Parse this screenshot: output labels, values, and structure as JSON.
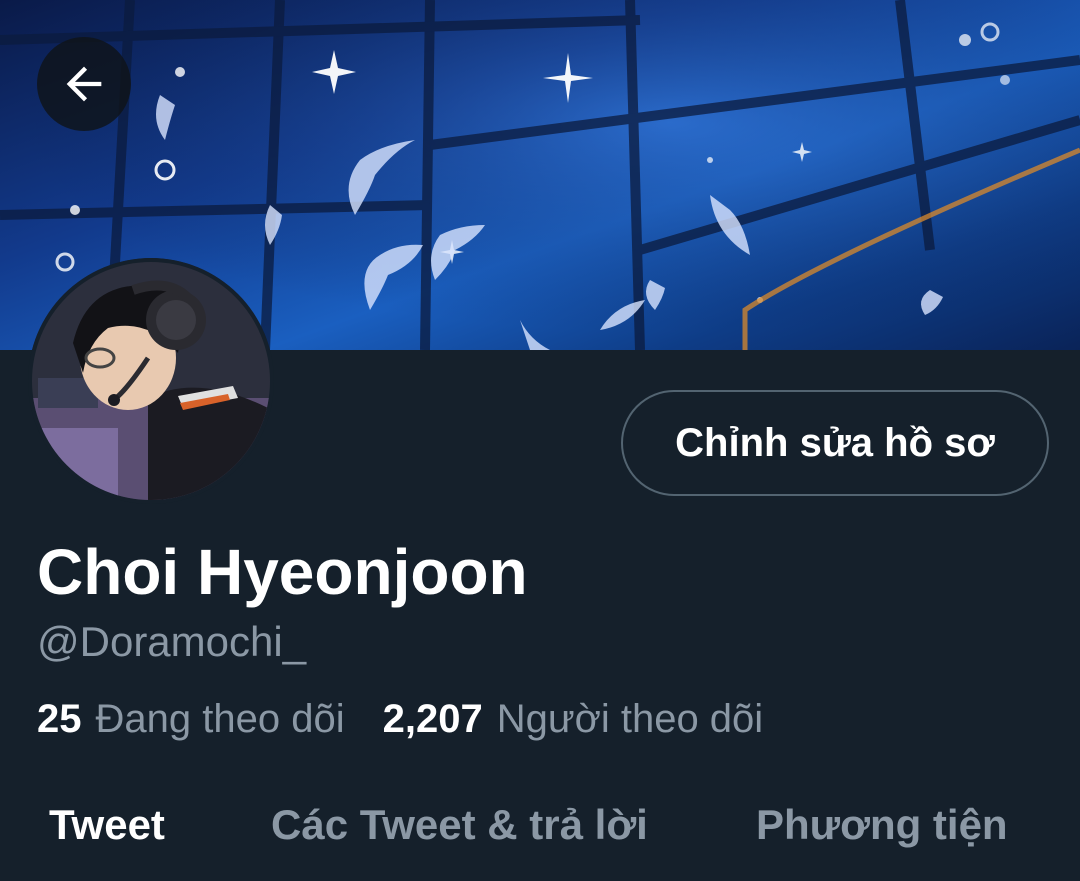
{
  "header": {
    "back_icon": "arrow-left-icon"
  },
  "profile": {
    "edit_button_label": "Chỉnh sửa hồ sơ",
    "display_name": "Choi Hyeonjoon",
    "handle": "@Doramochi_",
    "following_count": "25",
    "following_label": "Đang theo dõi",
    "followers_count": "2,207",
    "followers_label": "Người theo dõi"
  },
  "tabs": [
    {
      "label": "Tweet",
      "active": true
    },
    {
      "label": "Các Tweet & trả lời",
      "active": false
    },
    {
      "label": "Phương tiện",
      "active": false
    }
  ],
  "colors": {
    "background": "#15202b",
    "secondary_text": "#8b98a5",
    "border": "#536471"
  }
}
